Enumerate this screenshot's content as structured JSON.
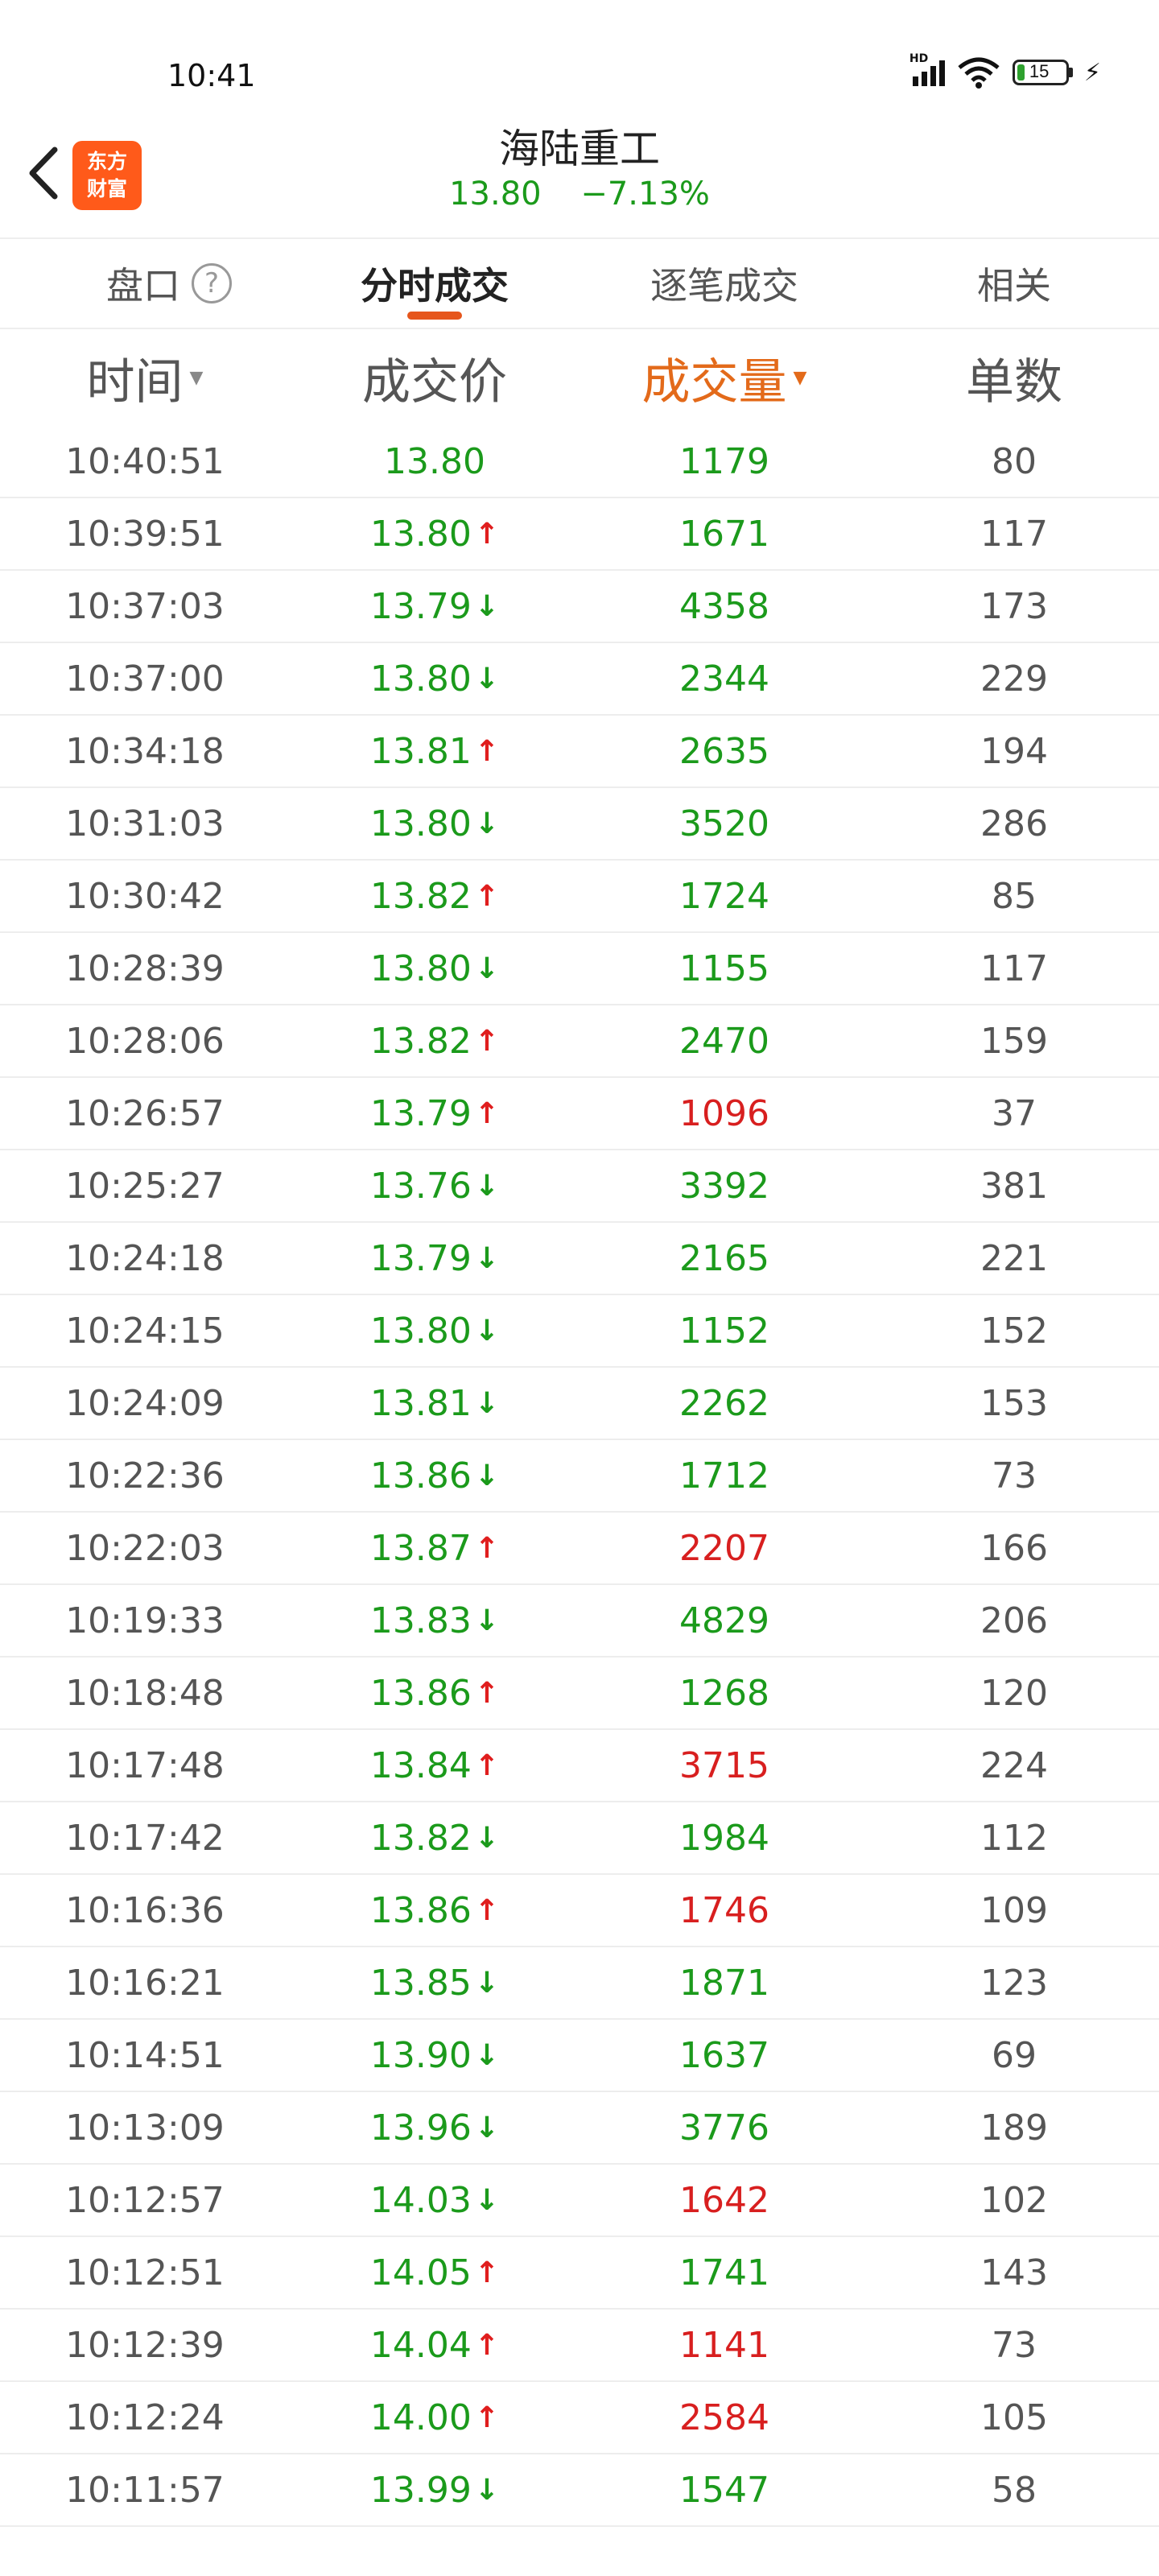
{
  "status": {
    "time": "10:41",
    "network": "HD",
    "battery": "15"
  },
  "header": {
    "logo_line1": "东方",
    "logo_line2": "财富",
    "stock_name": "海陆重工",
    "price": "13.80",
    "change": "−7.13%"
  },
  "tabs": [
    {
      "label": "盘口"
    },
    {
      "label": "分时成交"
    },
    {
      "label": "逐笔成交"
    },
    {
      "label": "相关"
    }
  ],
  "columns": {
    "time": "时间",
    "price": "成交价",
    "volume": "成交量",
    "count": "单数"
  },
  "rows": [
    {
      "time": "10:40:51",
      "price": "13.80",
      "dir": "",
      "volume": "1179",
      "vol_color": "green",
      "count": "80"
    },
    {
      "time": "10:39:51",
      "price": "13.80",
      "dir": "up",
      "volume": "1671",
      "vol_color": "green",
      "count": "117"
    },
    {
      "time": "10:37:03",
      "price": "13.79",
      "dir": "down",
      "volume": "4358",
      "vol_color": "green",
      "count": "173"
    },
    {
      "time": "10:37:00",
      "price": "13.80",
      "dir": "down",
      "volume": "2344",
      "vol_color": "green",
      "count": "229"
    },
    {
      "time": "10:34:18",
      "price": "13.81",
      "dir": "up",
      "volume": "2635",
      "vol_color": "green",
      "count": "194"
    },
    {
      "time": "10:31:03",
      "price": "13.80",
      "dir": "down",
      "volume": "3520",
      "vol_color": "green",
      "count": "286"
    },
    {
      "time": "10:30:42",
      "price": "13.82",
      "dir": "up",
      "volume": "1724",
      "vol_color": "green",
      "count": "85"
    },
    {
      "time": "10:28:39",
      "price": "13.80",
      "dir": "down",
      "volume": "1155",
      "vol_color": "green",
      "count": "117"
    },
    {
      "time": "10:28:06",
      "price": "13.82",
      "dir": "up",
      "volume": "2470",
      "vol_color": "green",
      "count": "159"
    },
    {
      "time": "10:26:57",
      "price": "13.79",
      "dir": "up",
      "volume": "1096",
      "vol_color": "red",
      "count": "37"
    },
    {
      "time": "10:25:27",
      "price": "13.76",
      "dir": "down",
      "volume": "3392",
      "vol_color": "green",
      "count": "381"
    },
    {
      "time": "10:24:18",
      "price": "13.79",
      "dir": "down",
      "volume": "2165",
      "vol_color": "green",
      "count": "221"
    },
    {
      "time": "10:24:15",
      "price": "13.80",
      "dir": "down",
      "volume": "1152",
      "vol_color": "green",
      "count": "152"
    },
    {
      "time": "10:24:09",
      "price": "13.81",
      "dir": "down",
      "volume": "2262",
      "vol_color": "green",
      "count": "153"
    },
    {
      "time": "10:22:36",
      "price": "13.86",
      "dir": "down",
      "volume": "1712",
      "vol_color": "green",
      "count": "73"
    },
    {
      "time": "10:22:03",
      "price": "13.87",
      "dir": "up",
      "volume": "2207",
      "vol_color": "red",
      "count": "166"
    },
    {
      "time": "10:19:33",
      "price": "13.83",
      "dir": "down",
      "volume": "4829",
      "vol_color": "green",
      "count": "206"
    },
    {
      "time": "10:18:48",
      "price": "13.86",
      "dir": "up",
      "volume": "1268",
      "vol_color": "green",
      "count": "120"
    },
    {
      "time": "10:17:48",
      "price": "13.84",
      "dir": "up",
      "volume": "3715",
      "vol_color": "red",
      "count": "224"
    },
    {
      "time": "10:17:42",
      "price": "13.82",
      "dir": "down",
      "volume": "1984",
      "vol_color": "green",
      "count": "112"
    },
    {
      "time": "10:16:36",
      "price": "13.86",
      "dir": "up",
      "volume": "1746",
      "vol_color": "red",
      "count": "109"
    },
    {
      "time": "10:16:21",
      "price": "13.85",
      "dir": "down",
      "volume": "1871",
      "vol_color": "green",
      "count": "123"
    },
    {
      "time": "10:14:51",
      "price": "13.90",
      "dir": "down",
      "volume": "1637",
      "vol_color": "green",
      "count": "69"
    },
    {
      "time": "10:13:09",
      "price": "13.96",
      "dir": "down",
      "volume": "3776",
      "vol_color": "green",
      "count": "189"
    },
    {
      "time": "10:12:57",
      "price": "14.03",
      "dir": "down",
      "volume": "1642",
      "vol_color": "red",
      "count": "102"
    },
    {
      "time": "10:12:51",
      "price": "14.05",
      "dir": "up",
      "volume": "1741",
      "vol_color": "green",
      "count": "143"
    },
    {
      "time": "10:12:39",
      "price": "14.04",
      "dir": "up",
      "volume": "1141",
      "vol_color": "red",
      "count": "73"
    },
    {
      "time": "10:12:24",
      "price": "14.00",
      "dir": "up",
      "volume": "2584",
      "vol_color": "red",
      "count": "105"
    },
    {
      "time": "10:11:57",
      "price": "13.99",
      "dir": "down",
      "volume": "1547",
      "vol_color": "green",
      "count": "58"
    }
  ]
}
